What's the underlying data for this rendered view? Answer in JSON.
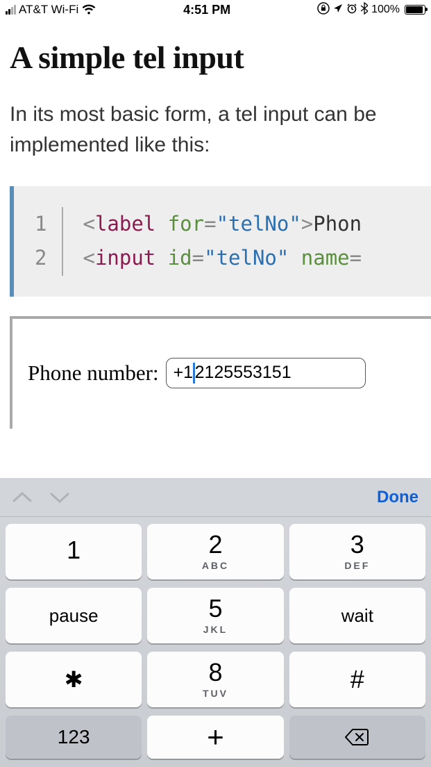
{
  "status": {
    "carrier": "AT&T Wi-Fi",
    "time": "4:51 PM",
    "battery_pct": "100%"
  },
  "page": {
    "heading": "A simple tel input",
    "intro": "In its most basic form, a tel input can be implemented like this:"
  },
  "code": {
    "line_numbers": [
      "1",
      "2"
    ],
    "line1": {
      "punc1": "<",
      "tag": "label",
      "attr": "for",
      "eq": "=",
      "str": "\"telNo\"",
      "punc2": ">",
      "text": "Phon"
    },
    "line2": {
      "punc1": "<",
      "tag": "input",
      "attr1": "id",
      "eq1": "=",
      "str1": "\"telNo\"",
      "attr2": "name",
      "eq2": "="
    }
  },
  "example": {
    "label": "Phone number:",
    "value_pre": "+1",
    "value_post": "2125553151"
  },
  "keyboard": {
    "done": "Done",
    "keys": {
      "k1": "1",
      "k1_sub": "",
      "k2": "2",
      "k2_sub": "ABC",
      "k3": "3",
      "k3_sub": "DEF",
      "pause": "pause",
      "k5": "5",
      "k5_sub": "JKL",
      "wait": "wait",
      "star": "✱",
      "k8": "8",
      "k8_sub": "TUV",
      "hash": "#",
      "mode": "123",
      "plus": "+"
    }
  }
}
